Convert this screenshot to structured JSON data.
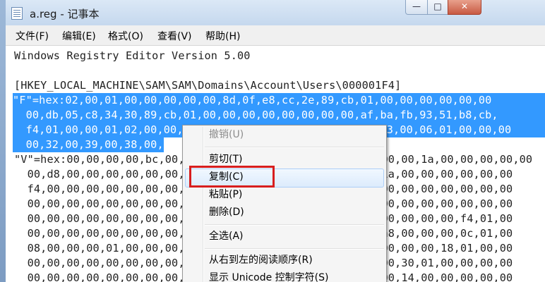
{
  "window": {
    "title": "a.reg - 记事本",
    "min_glyph": "—",
    "max_glyph": "□",
    "close_glyph": "✕"
  },
  "menu": [
    "文件(F)",
    "编辑(E)",
    "格式(O)",
    "查看(V)",
    "帮助(H)"
  ],
  "editor": {
    "lines": [
      "Windows Registry Editor Version 5.00",
      "",
      "[HKEY_LOCAL_MACHINE\\SAM\\SAM\\Domains\\Account\\Users\\000001F4]",
      "\"F\"=hex:02,00,01,00,00,00,00,00,8d,0f,e8,cc,2e,89,cb,01,00,00,00,00,00,00",
      "  00,db,05,c8,34,30,89,cb,01,00,00,00,00,00,00,00,00,af,ba,fb,93,51,b8,cb,",
      "  f4,01,00,00,01,02,00,00,14,02,00,00,00,00,00,00,00,00,03,00,06,01,00,00,00",
      "  00,32,00,39,00,38,00,",
      "\"V\"=hex:00,00,00,00,bc,00,00,00,02,00,01,00,bc,00,00,00,00,00,1a,00,00,00,00,00",
      "  00,d8,00,00,00,00,00,00,00,00,00,00,00,00,00,00,00,00,1a,00,00,00,00,00,00",
      "  f4,00,00,00,00,00,00,00,00,00,00,00,00,00,00,00,00,00,00,00,00,00,00,00,00",
      "  00,00,00,00,00,00,00,00,00,00,00,00,00,00,00,00,00,00,00,00,00,00,00,00,00",
      "  00,00,00,00,00,00,00,00,00,00,00,00,00,00,00,00,00,00,00,00,00,00,f4,01,00",
      "  00,00,00,00,00,00,00,00,00,00,00,00,00,00,00,00,00,00,a8,00,00,00,0c,01,00",
      "  08,00,00,00,01,00,00,00,00,00,00,00,00,00,00,00,00,00,00,00,00,18,01,00,00",
      "  00,00,00,00,00,00,00,00,00,00,00,00,00,00,00,00,00,00,00,30,01,00,00,00,00",
      "  00,00,00,00,00,00,00,00,01,00,00,00,00,00,00,00,00,00,00,14,00,00,00,00,00"
    ]
  },
  "context_menu": {
    "items": [
      "撤销(U)",
      "剪切(T)",
      "复制(C)",
      "粘贴(P)",
      "删除(D)",
      "全选(A)",
      "从右到左的阅读顺序(R)",
      "显示 Unicode 控制字符(S)"
    ],
    "highlighted": "复制(C)",
    "disabled": [
      "撤销(U)"
    ]
  },
  "colors": {
    "selection": "#3399ff",
    "annotation_box": "#d81e1e",
    "titlebar": "#c5d8ee"
  }
}
